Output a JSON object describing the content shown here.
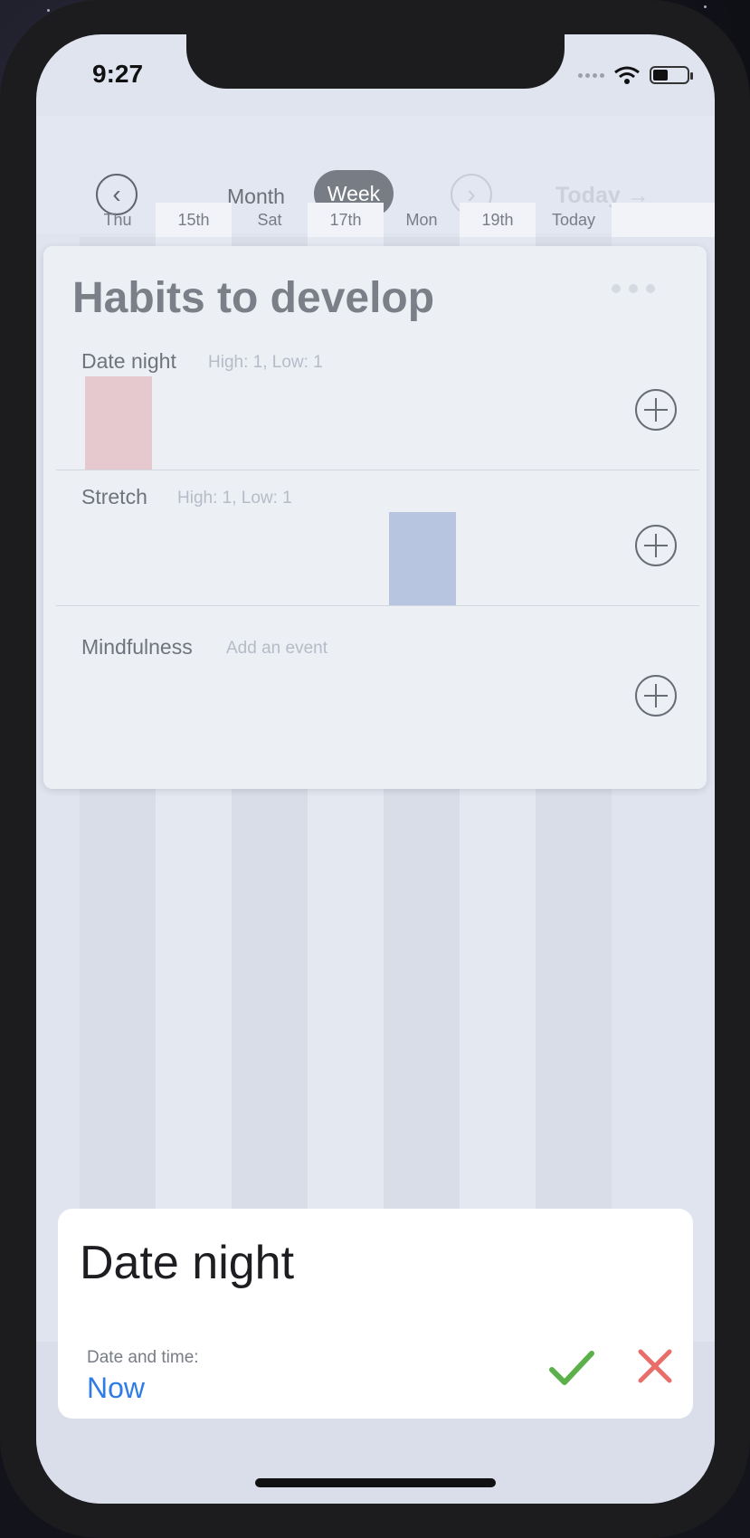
{
  "status_bar": {
    "time": "9:27"
  },
  "header": {
    "view_toggle": {
      "month_label": "Month",
      "week_label": "Week",
      "selected": "Week"
    },
    "today_label": "Today →"
  },
  "day_strip": [
    "Thu",
    "15th",
    "Sat",
    "17th",
    "Mon",
    "19th",
    "Today"
  ],
  "card": {
    "title": "Habits to develop",
    "habits": [
      {
        "name": "Date night",
        "subtitle": "High: 1, Low: 1",
        "bar_day": "Thu",
        "bar_color": "#e6c8cf"
      },
      {
        "name": "Stretch",
        "subtitle": "High: 1, Low: 1",
        "bar_day": "Mon",
        "bar_color": "#b8c5e0"
      },
      {
        "name": "Mindfulness",
        "subtitle": "Add an event"
      }
    ]
  },
  "sheet": {
    "title": "Date night",
    "date_label": "Date and time:",
    "date_value": "Now"
  },
  "colors": {
    "accent_blue": "#2f7ce6",
    "confirm_green": "#5bb04a",
    "cancel_red": "#e96e6a"
  }
}
